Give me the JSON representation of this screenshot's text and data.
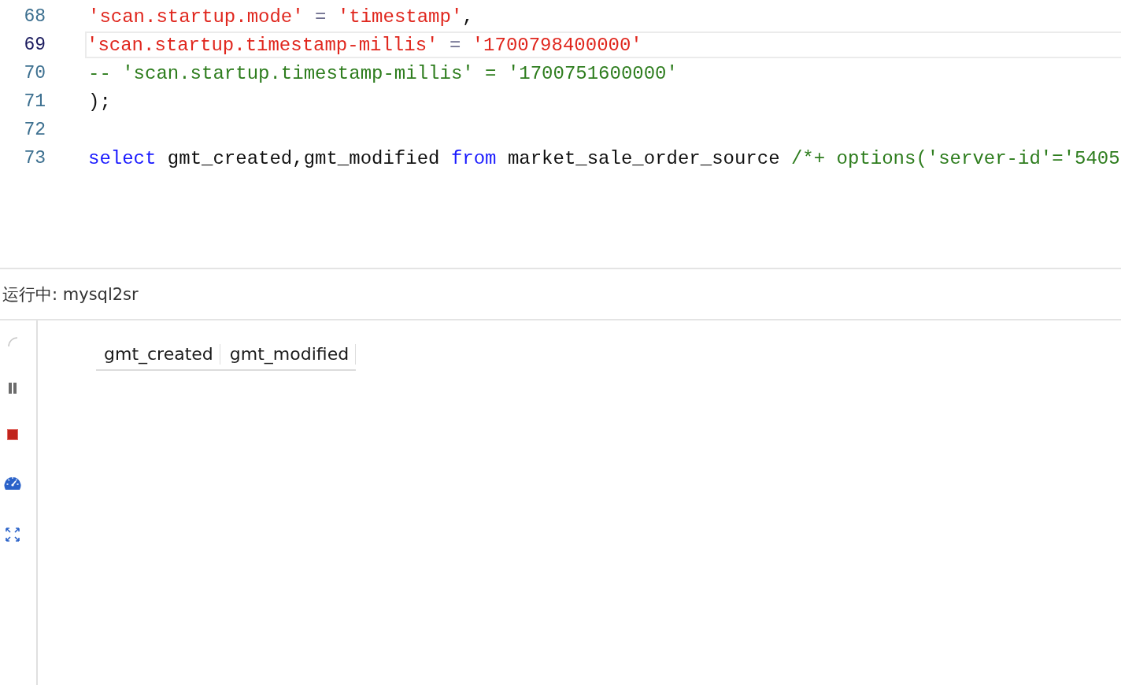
{
  "editor": {
    "lines": [
      {
        "number": "68",
        "current": false,
        "tokens": [
          {
            "text": "'scan.startup.mode'",
            "kind": "string"
          },
          {
            "text": " = ",
            "kind": "operator"
          },
          {
            "text": "'timestamp'",
            "kind": "string"
          },
          {
            "text": ",",
            "kind": "plain"
          }
        ]
      },
      {
        "number": "69",
        "current": true,
        "tokens": [
          {
            "text": "'scan.startup.timestamp-millis'",
            "kind": "string"
          },
          {
            "text": " = ",
            "kind": "operator"
          },
          {
            "text": "'1700798400000'",
            "kind": "string"
          }
        ]
      },
      {
        "number": "70",
        "current": false,
        "tokens": [
          {
            "text": "-- 'scan.startup.timestamp-millis' = '1700751600000'",
            "kind": "comment"
          }
        ]
      },
      {
        "number": "71",
        "current": false,
        "tokens": [
          {
            "text": ");",
            "kind": "plain"
          }
        ]
      },
      {
        "number": "72",
        "current": false
      },
      {
        "number": "73",
        "current": false,
        "tokens": [
          {
            "text": "select",
            "kind": "keyword"
          },
          {
            "text": " gmt_created,gmt_modified ",
            "kind": "plain"
          },
          {
            "text": "from",
            "kind": "keyword"
          },
          {
            "text": " market_sale_order_source ",
            "kind": "plain"
          },
          {
            "text": "/*+ options('server-id'='5405",
            "kind": "comment"
          }
        ]
      }
    ]
  },
  "run_panel": {
    "title": "运行中: mysql2sr",
    "toolbar": [
      {
        "kind": "spinner"
      },
      {
        "kind": "pause"
      },
      {
        "kind": "stop"
      },
      {
        "kind": "gauge"
      },
      {
        "kind": "expand"
      }
    ],
    "table": {
      "columns": [
        "gmt_created",
        "gmt_modified"
      ]
    }
  }
}
